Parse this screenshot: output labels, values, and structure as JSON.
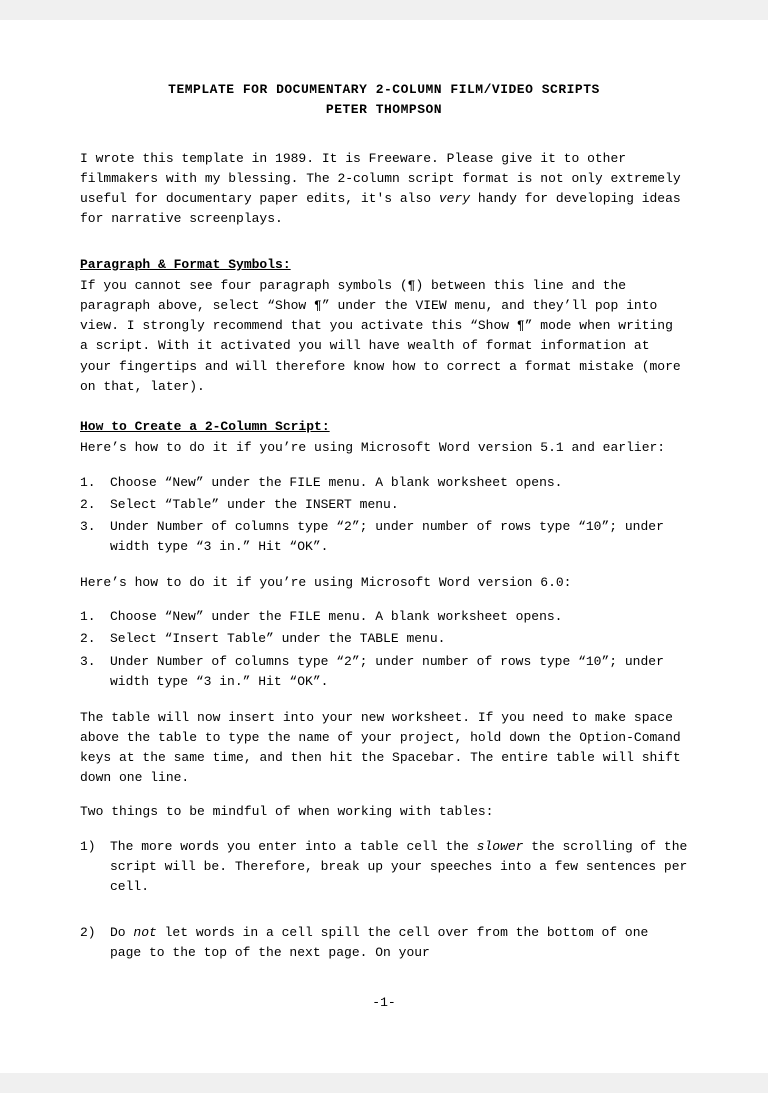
{
  "title": {
    "main": "TEMPLATE FOR DOCUMENTARY 2-COLUMN FILM/VIDEO SCRIPTS",
    "author": "PETER THOMPSON"
  },
  "intro": {
    "text": "I wrote this template in 1989.  It is Freeware.  Please give it to other filmmakers with my blessing. The 2-column script format is not only extremely useful for documentary paper edits, it's also very handy for developing ideas for narrative screenplays."
  },
  "sections": [
    {
      "id": "paragraph-format",
      "heading": "Paragraph & Format Symbols:",
      "body": "If you cannot see four paragraph symbols (¶) between this line and the paragraph above, select “Show ¶” under the VIEW menu, and they’ll pop into view.  I strongly recommend that you activate this “Show ¶” mode when writing a script.  With it activated you will have wealth of format information at your fingertips and will therefore know how to correct a format mistake (more on that, later)."
    },
    {
      "id": "how-to-create",
      "heading": "How to Create a 2-Column Script:",
      "intro": "Here’s how to do it if you’re using Microsoft Word version 5.1 and earlier:",
      "list1": [
        {
          "num": "1.",
          "text": "Choose “New” under the FILE menu.  A blank worksheet opens."
        },
        {
          "num": "2.",
          "text": "Select “Table” under the INSERT menu."
        },
        {
          "num": "3.",
          "text": "Under Number of columns type “2”; under number of rows type “10”; under width type “3 in.”   Hit “OK”."
        }
      ],
      "intro2": "Here’s how to do it if you’re using Microsoft Word version 6.0:",
      "list2": [
        {
          "num": "1.",
          "text": "Choose “New” under the FILE menu.  A blank worksheet opens."
        },
        {
          "num": "2.",
          "text": "Select “Insert Table” under the TABLE menu."
        },
        {
          "num": "3.",
          "text": "Under Number of columns type “2”; under number of rows type “10”; under width type “3 in.”   Hit “OK”."
        }
      ],
      "para1": "The table will now insert into your new worksheet.  If you need to make space above the table to type the name of your project, hold down the Option-Comand keys at the same time, and then hit the Spacebar.  The entire table will shift down one line.",
      "para2": "Two things to be mindful of when working with tables:",
      "list3": [
        {
          "num": "1)",
          "text": "The more words you enter into a table cell the slower the scrolling of the script will be.  Therefore, break up your speeches into a few sentences per cell."
        }
      ],
      "list4": [
        {
          "num": "2)",
          "text": "Do not let words in a cell spill the cell over from the bottom of one  page to the top of the next page.  On your"
        }
      ]
    }
  ],
  "page_number": "-1-"
}
